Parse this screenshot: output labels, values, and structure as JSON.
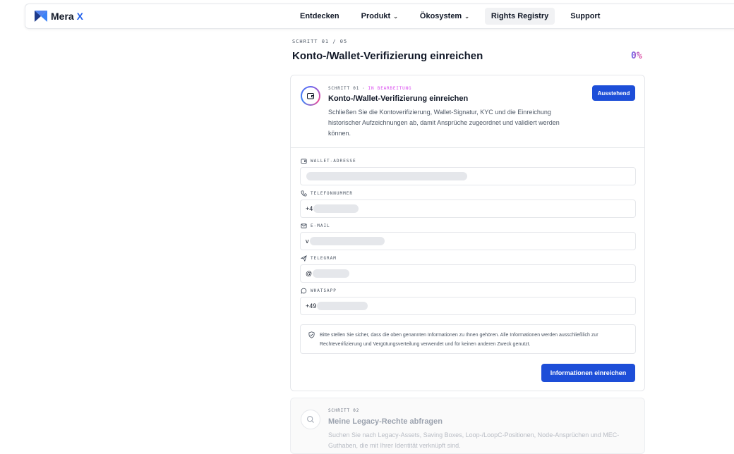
{
  "brand": {
    "name": "Mera",
    "suffix": "X"
  },
  "nav": {
    "items": [
      {
        "label": "Entdecken"
      },
      {
        "label": "Produkt"
      },
      {
        "label": "Ökosystem"
      },
      {
        "label": "Rights Registry"
      },
      {
        "label": "Support"
      }
    ]
  },
  "page": {
    "step_kicker": "SCHRITT 01 / 05",
    "title": "Konto-/Wallet-Verifizierung einreichen",
    "progress_text": "0%",
    "progress_value": 0
  },
  "step1": {
    "kicker_step": "SCHRITT 01",
    "kicker_sep": "·",
    "kicker_status": "IN BEARBEITUNG",
    "title": "Konto-/Wallet-Verifizierung einreichen",
    "description": "Schließen Sie die Kontoverifizierung, Wallet-Signatur, KYC und die Einreichung historischer Aufzeichnungen ab, damit Ansprüche zugeordnet und validiert werden können.",
    "badge": "Ausstehend",
    "fields": {
      "wallet": {
        "label": "WALLET-ADRESSE",
        "value": ""
      },
      "phone": {
        "label": "TELEFONNUMMER",
        "value": "+4"
      },
      "email": {
        "label": "E-MAIL",
        "value": "v"
      },
      "telegram": {
        "label": "TELEGRAM",
        "value": "@"
      },
      "whatsapp": {
        "label": "WHATSAPP",
        "value": "+49"
      }
    },
    "notice": "Bitte stellen Sie sicher, dass die oben genannten Informationen zu Ihnen gehören. Alle Informationen werden ausschließlich zur Rechteverifizierung und Vergütungsverteilung verwendet und für keinen anderen Zweck genutzt.",
    "submit_label": "Informationen einreichen"
  },
  "step2": {
    "kicker": "SCHRITT 02",
    "title": "Meine Legacy-Rechte abfragen",
    "description": "Suchen Sie nach Legacy-Assets, Saving Boxes, Loop-/LoopC-Positionen, Node-Ansprüchen und MEC-Guthaben, die mit Ihrer Identität verknüpft sind."
  },
  "colors": {
    "accent": "#1d4ed8",
    "status": "#d946ef",
    "brand_x": "#2563eb"
  }
}
